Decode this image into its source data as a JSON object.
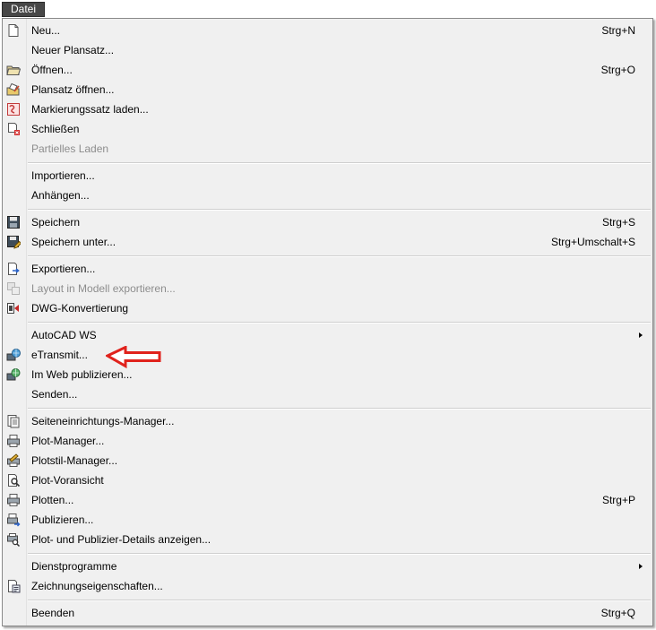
{
  "menubar": {
    "title": "Datei"
  },
  "menu": {
    "items": [
      {
        "label": "Neu...",
        "shortcut": "Strg+N",
        "icon": "new-file-icon"
      },
      {
        "label": "Neuer Plansatz...",
        "shortcut": ""
      },
      {
        "label": "Öffnen...",
        "shortcut": "Strg+O",
        "icon": "open-folder-icon"
      },
      {
        "label": "Plansatz öffnen...",
        "shortcut": "",
        "icon": "open-sheet-set-icon"
      },
      {
        "label": "Markierungssatz laden...",
        "shortcut": "",
        "icon": "markup-set-icon"
      },
      {
        "label": "Schließen",
        "shortcut": "",
        "icon": "close-document-icon"
      },
      {
        "label": "Partielles Laden",
        "shortcut": "",
        "disabled": true
      },
      {
        "label": "Importieren...",
        "shortcut": ""
      },
      {
        "label": "Anhängen...",
        "shortcut": ""
      },
      {
        "label": "Speichern",
        "shortcut": "Strg+S",
        "icon": "save-icon"
      },
      {
        "label": "Speichern unter...",
        "shortcut": "Strg+Umschalt+S",
        "icon": "save-as-icon"
      },
      {
        "label": "Exportieren...",
        "shortcut": "",
        "icon": "export-icon"
      },
      {
        "label": "Layout in Modell exportieren...",
        "shortcut": "",
        "icon": "layout-to-model-icon",
        "disabled": true
      },
      {
        "label": "DWG-Konvertierung",
        "shortcut": "",
        "icon": "dwg-convert-icon"
      },
      {
        "label": "AutoCAD WS",
        "shortcut": "",
        "submenu": true
      },
      {
        "label": "eTransmit...",
        "shortcut": "",
        "icon": "etransmit-icon"
      },
      {
        "label": "Im Web publizieren...",
        "shortcut": "",
        "icon": "publish-web-icon"
      },
      {
        "label": "Senden...",
        "shortcut": ""
      },
      {
        "label": "Seiteneinrichtungs-Manager...",
        "shortcut": "",
        "icon": "page-setup-icon"
      },
      {
        "label": "Plot-Manager...",
        "shortcut": "",
        "icon": "plotter-manager-icon"
      },
      {
        "label": "Plotstil-Manager...",
        "shortcut": "",
        "icon": "plot-style-icon"
      },
      {
        "label": "Plot-Voransicht",
        "shortcut": "",
        "icon": "plot-preview-icon"
      },
      {
        "label": "Plotten...",
        "shortcut": "Strg+P",
        "icon": "plot-icon"
      },
      {
        "label": "Publizieren...",
        "shortcut": "",
        "icon": "publish-icon"
      },
      {
        "label": "Plot- und Publizier-Details anzeigen...",
        "shortcut": "",
        "icon": "plot-details-icon"
      },
      {
        "label": "Dienstprogramme",
        "shortcut": "",
        "submenu": true
      },
      {
        "label": "Zeichnungseigenschaften...",
        "shortcut": "",
        "icon": "drawing-properties-icon"
      },
      {
        "label": "Beenden",
        "shortcut": "Strg+Q"
      }
    ]
  },
  "colors": {
    "annotation_arrow": "#e0221c",
    "menubar_active": "#474747",
    "menu_background": "#f0f0f0"
  }
}
